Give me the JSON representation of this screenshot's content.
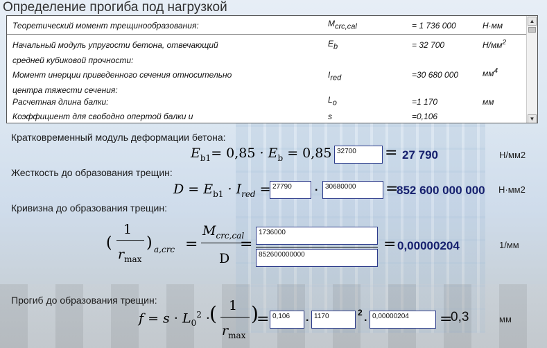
{
  "title": "Определение прогиба под нагрузкой",
  "params": [
    {
      "label": "Теоретический момент трещинообразования:",
      "symbol": "M",
      "sub": "crc,cal",
      "value": "= 1 736 000",
      "unit": "Н·мм"
    },
    {
      "label": "Начальный модуль упругости бетона, отвечающий",
      "label2": "средней кубиковой прочности:",
      "symbol": "E",
      "sub": "b",
      "value": "= 32 700",
      "unit": "Н/мм",
      "unit_sup": "2"
    },
    {
      "label": "Момент инерции приведенного сечения относительно",
      "label2": "центра тяжести сечения:",
      "symbol": "I",
      "sub": "red",
      "value": "=30 680 000",
      "unit": "мм",
      "unit_sup": "4"
    },
    {
      "label": "Расчетная длина балки:",
      "symbol": "L",
      "sub": "o",
      "value": "=1 170",
      "unit": "мм"
    },
    {
      "label": "Коэффициент для свободно опертой балки и",
      "symbol": "s",
      "sub": "",
      "value": "=0,106",
      "unit": ""
    }
  ],
  "scroll": {
    "up": "▲",
    "down": "▼"
  },
  "sections": {
    "e1": {
      "heading": "Кратковременный модуль деформации бетона:",
      "lhs": "E",
      "lhs_sub": "b1",
      "coef": "= 0,85 · ",
      "eb": "E",
      "eb_sub": "b",
      "mid": " = 0,85 · ",
      "box": "32700",
      "eq": "=",
      "result": "27 790",
      "unit": "Н/мм2"
    },
    "d": {
      "heading": "Жесткость до образования трещин:",
      "lhs": "D",
      "eq1": " = ",
      "e": "E",
      "e_sub": "b1",
      "dot": " · ",
      "i": "I",
      "i_sub": "red",
      "eq2": " = ",
      "box1": "27790",
      "op": "·",
      "box2": "30680000",
      "eq": "=",
      "result": "852 600 000 000",
      "unit": "Н·мм2"
    },
    "k": {
      "heading": "Кривизна до образования трещин:",
      "lparen": "(",
      "one": "1",
      "r": "r",
      "r_sub": "max",
      "rparen": ")",
      "sub": "a,crc",
      "eq1": "=",
      "num": "M",
      "num_sub": "crc,cal",
      "den": "D",
      "eq2": "=",
      "box_num": "1736000",
      "box_den": "852600000000",
      "eq": "=",
      "result": "0,00000204",
      "unit": "1/мм"
    },
    "f": {
      "heading": "Прогиб до образования трещин:",
      "lhs": "f",
      "eq1": " = ",
      "s": "s",
      "dot1": " · ",
      "l": "L",
      "l_sub": "0",
      "l_sup": "2",
      "dot2": " · ",
      "lparen": "(",
      "one": "1",
      "r": "r",
      "r_sub": "max",
      "rparen": ")",
      "eq2": "=",
      "box1": "0,106",
      "op1": "·",
      "box2": "1170",
      "op2": "2",
      "op3": "·",
      "box3": "0,00000204",
      "eq": "=",
      "result": "0,3",
      "unit": "мм"
    }
  }
}
